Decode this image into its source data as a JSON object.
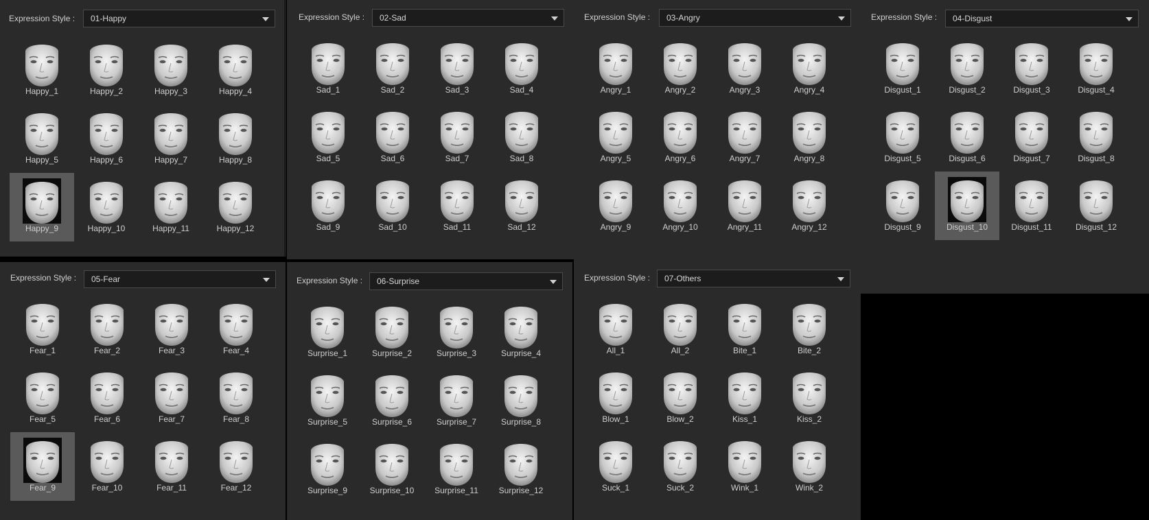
{
  "style_label": "Expression Style :",
  "panels": [
    {
      "selected": "01-Happy",
      "items": [
        "Happy_1",
        "Happy_2",
        "Happy_3",
        "Happy_4",
        "Happy_5",
        "Happy_6",
        "Happy_7",
        "Happy_8",
        "Happy_9",
        "Happy_10",
        "Happy_11",
        "Happy_12"
      ],
      "highlighted": "Happy_9"
    },
    {
      "selected": "02-Sad",
      "items": [
        "Sad_1",
        "Sad_2",
        "Sad_3",
        "Sad_4",
        "Sad_5",
        "Sad_6",
        "Sad_7",
        "Sad_8",
        "Sad_9",
        "Sad_10",
        "Sad_11",
        "Sad_12"
      ],
      "highlighted": null
    },
    {
      "selected": "03-Angry",
      "items": [
        "Angry_1",
        "Angry_2",
        "Angry_3",
        "Angry_4",
        "Angry_5",
        "Angry_6",
        "Angry_7",
        "Angry_8",
        "Angry_9",
        "Angry_10",
        "Angry_11",
        "Angry_12"
      ],
      "highlighted": null
    },
    {
      "selected": "04-Disgust",
      "items": [
        "Disgust_1",
        "Disgust_2",
        "Disgust_3",
        "Disgust_4",
        "Disgust_5",
        "Disgust_6",
        "Disgust_7",
        "Disgust_8",
        "Disgust_9",
        "Disgust_10",
        "Disgust_11",
        "Disgust_12"
      ],
      "highlighted": "Disgust_10"
    },
    {
      "selected": "05-Fear",
      "items": [
        "Fear_1",
        "Fear_2",
        "Fear_3",
        "Fear_4",
        "Fear_5",
        "Fear_6",
        "Fear_7",
        "Fear_8",
        "Fear_9",
        "Fear_10",
        "Fear_11",
        "Fear_12"
      ],
      "highlighted": "Fear_9"
    },
    {
      "selected": "06-Surprise",
      "items": [
        "Surprise_1",
        "Surprise_2",
        "Surprise_3",
        "Surprise_4",
        "Surprise_5",
        "Surprise_6",
        "Surprise_7",
        "Surprise_8",
        "Surprise_9",
        "Surprise_10",
        "Surprise_11",
        "Surprise_12"
      ],
      "highlighted": null
    },
    {
      "selected": "07-Others",
      "items": [
        "All_1",
        "All_2",
        "Bite_1",
        "Bite_2",
        "Blow_1",
        "Blow_2",
        "Kiss_1",
        "Kiss_2",
        "Suck_1",
        "Suck_2",
        "Wink_1",
        "Wink_2"
      ],
      "highlighted": null
    }
  ],
  "colors": {
    "panel_bg": "#2a2a2a",
    "dropdown_bg": "#1c1c1c",
    "selected_tile": "#5a5a5a",
    "outer_bg": "#000000",
    "label_text": "#cfcfcf"
  },
  "thumbnail_icon": "face-expression-thumbnail",
  "dropdown_icon": "chevron-down-icon"
}
